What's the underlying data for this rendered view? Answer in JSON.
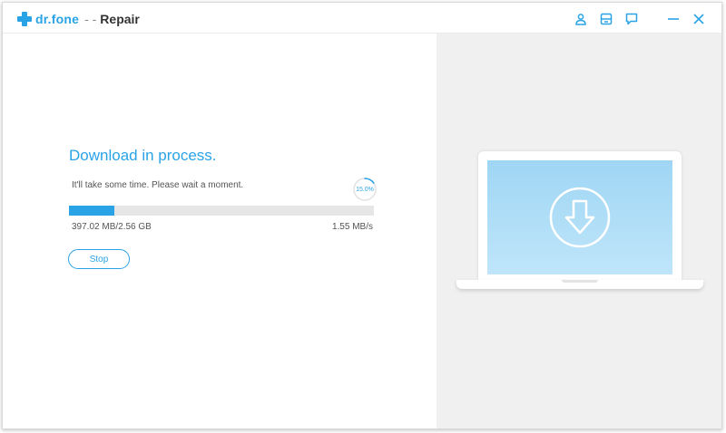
{
  "window": {
    "brand": "dr.fone",
    "separator": "- -",
    "module": "Repair"
  },
  "title_icons": [
    "user-icon",
    "save-icon",
    "feedback-icon",
    "minimize-icon",
    "close-icon"
  ],
  "download": {
    "heading": "Download in process.",
    "message": "It'll take some time. Please wait a moment.",
    "percent_label": "15.0%",
    "progress_fraction": 0.15,
    "size": "397.02 MB/2.56 GB",
    "speed": "1.55 MB/s",
    "stop_label": "Stop"
  },
  "illustration": {
    "icon": "download-arrow-icon"
  },
  "colors": {
    "accent": "#2aa3e6",
    "panel_bg": "#f0f0f0",
    "screen": "#a9dcf6"
  }
}
